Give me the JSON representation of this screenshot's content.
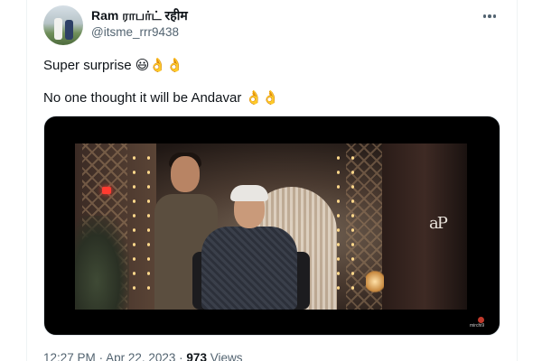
{
  "author": {
    "display_name": "Ram ராபர்ட் रहीम",
    "handle": "@itsme_rrr9438",
    "avatar": "profile-photo"
  },
  "tweet": {
    "line1": "Super surprise 😃👌👌",
    "line2": "No one thought it will be Andavar 👌👌"
  },
  "media": {
    "type": "video-still",
    "brand_mark": "aP",
    "watermark_text": "mirchi9"
  },
  "meta": {
    "time": "12:27 PM",
    "date": "Apr 22, 2023",
    "views_count": "973",
    "views_label": "Views",
    "separator": "·"
  },
  "icons": {
    "more": "more-horizontal-icon"
  },
  "colors": {
    "text_primary": "#0f1419",
    "text_secondary": "#536471",
    "border": "#eff3f4"
  }
}
